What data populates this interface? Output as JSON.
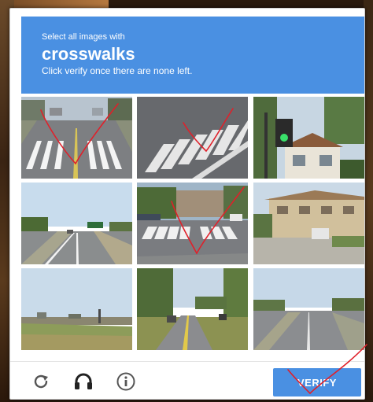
{
  "captcha": {
    "instruction_small": "Select all images with",
    "target_object": "crosswalks",
    "instruction_sub": "Click verify once there are none left.",
    "verify_label": "VERIFY",
    "tiles": [
      {
        "scene": "road-crosswalk",
        "marked": true
      },
      {
        "scene": "crosswalk-closeup",
        "marked": true
      },
      {
        "scene": "traffic-light",
        "marked": false
      },
      {
        "scene": "highway",
        "marked": false
      },
      {
        "scene": "intersection-crosswalk",
        "marked": true
      },
      {
        "scene": "apartment-building",
        "marked": false
      },
      {
        "scene": "shrubland",
        "marked": false
      },
      {
        "scene": "curved-road",
        "marked": false
      },
      {
        "scene": "wide-road",
        "marked": false
      }
    ],
    "footer_icons": [
      "reload-icon",
      "audio-challenge-icon",
      "info-icon"
    ],
    "colors": {
      "header_bg": "#4a90e2",
      "verify_bg": "#4a90e2",
      "annotation_stroke": "#e0202a"
    }
  }
}
